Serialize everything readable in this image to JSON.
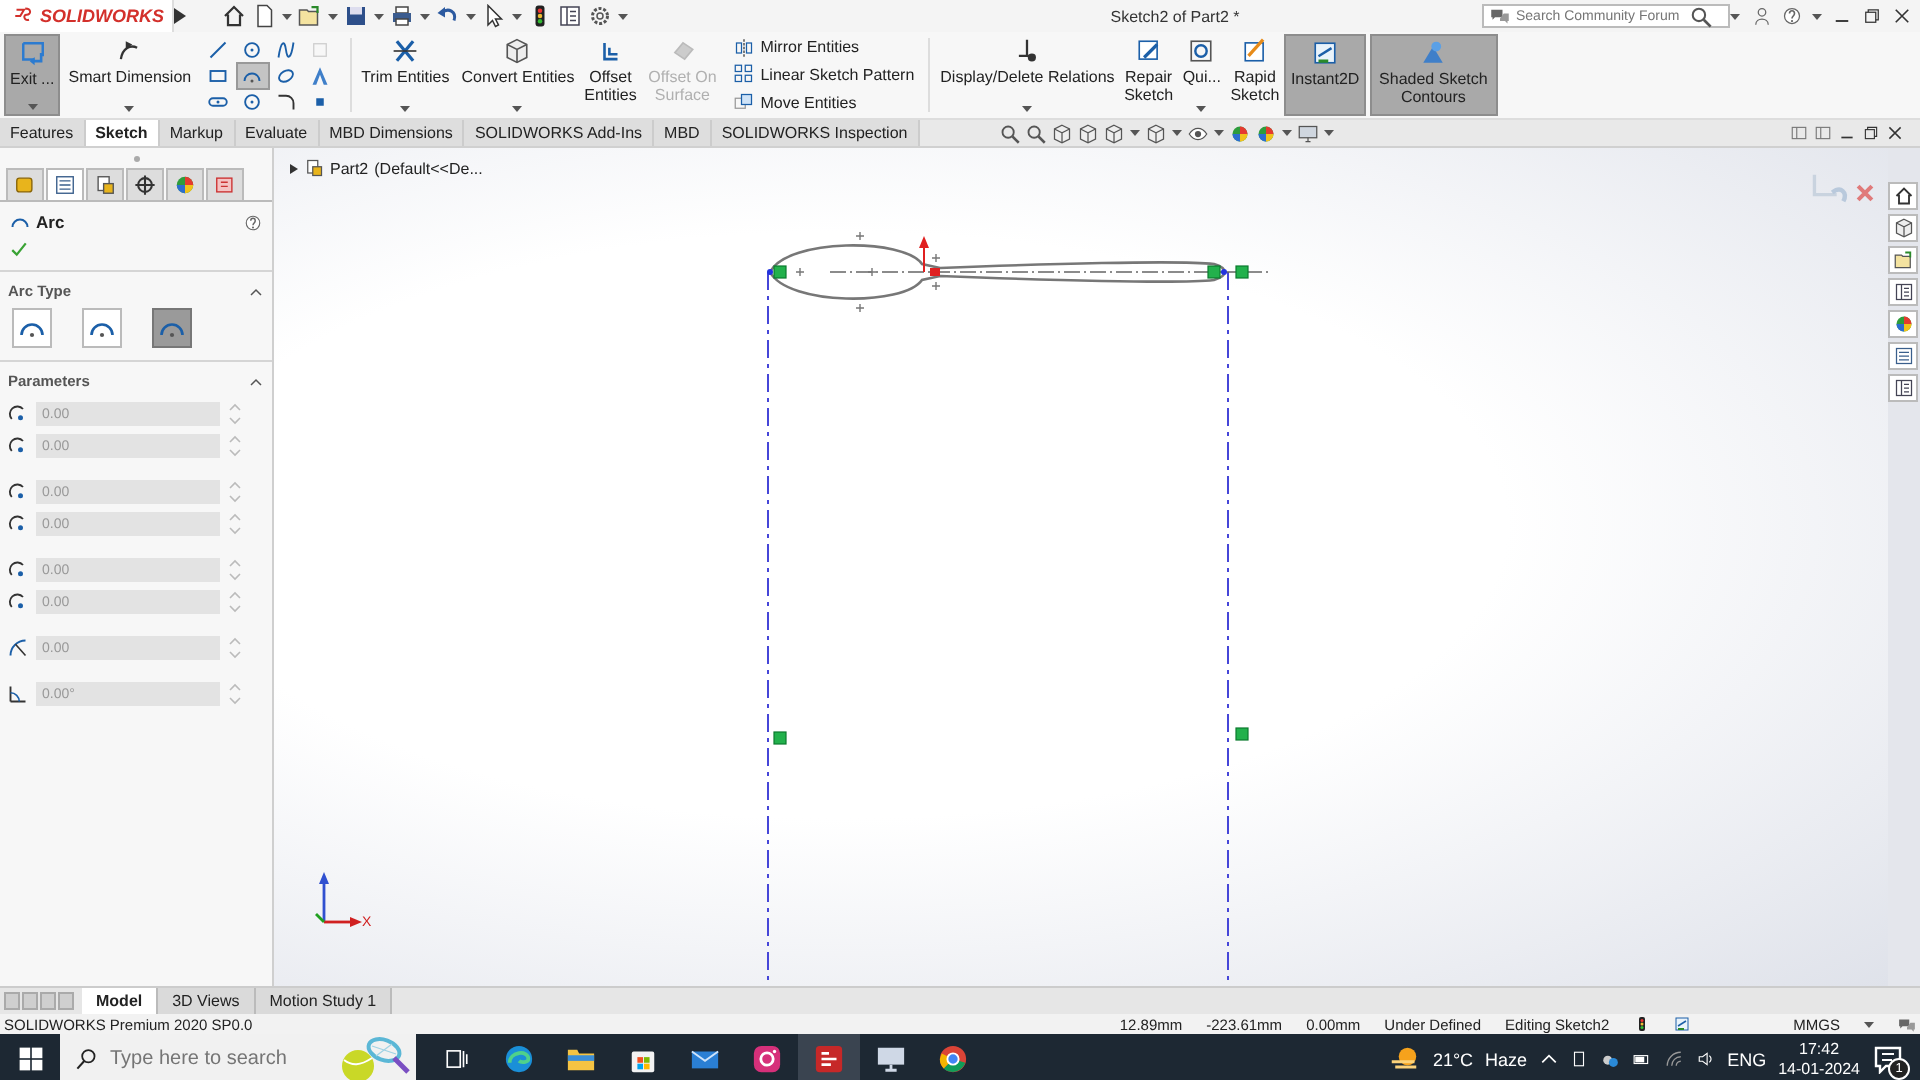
{
  "title_bar": {
    "brand": "SOLIDWORKS",
    "title": "Sketch2 of Part2 *",
    "search": {
      "placeholder": "Search Community Forum"
    }
  },
  "ribbon": [
    {
      "kind": "large",
      "label": "Exit ...",
      "selected": true,
      "disabled": false,
      "dropdown": true
    },
    {
      "kind": "large",
      "label": "Smart Dimension",
      "selected": false,
      "disabled": false,
      "dropdown": true
    },
    {
      "kind": "tools",
      "items": [
        {
          "selected": false
        },
        {
          "selected": false
        },
        {
          "selected": false
        },
        {
          "selected": false
        },
        {
          "selected": false
        },
        {
          "selected": true
        },
        {
          "selected": false
        },
        {
          "selected": false
        },
        {
          "selected": false
        },
        {
          "selected": false
        },
        {
          "selected": false
        },
        {
          "selected": false
        }
      ]
    },
    {
      "kind": "large",
      "label": "Trim Entities",
      "selected": false,
      "disabled": false,
      "dropdown": true
    },
    {
      "kind": "large",
      "label": "Convert Entities",
      "selected": false,
      "disabled": false,
      "dropdown": true
    },
    {
      "kind": "large",
      "label": "Offset Entities",
      "selected": false,
      "disabled": false,
      "dropdown": false
    },
    {
      "kind": "large",
      "label": "Offset On Surface",
      "selected": false,
      "disabled": true,
      "dropdown": false
    },
    {
      "kind": "stack",
      "items": [
        "Mirror Entities",
        "Linear Sketch Pattern",
        "Move Entities"
      ]
    },
    {
      "kind": "large",
      "label": "Display/Delete Relations",
      "selected": false,
      "disabled": false,
      "dropdown": true
    },
    {
      "kind": "large",
      "label": "Repair Sketch",
      "selected": false,
      "disabled": false,
      "dropdown": false
    },
    {
      "kind": "large",
      "label": "Qui...",
      "selected": false,
      "disabled": false,
      "dropdown": true
    },
    {
      "kind": "large",
      "label": "Rapid Sketch",
      "selected": false,
      "disabled": false,
      "dropdown": false
    },
    {
      "kind": "large",
      "label": "Instant2D",
      "selected": true,
      "disabled": false,
      "dropdown": false
    },
    {
      "kind": "large",
      "label": "Shaded Sketch Contours",
      "selected": true,
      "disabled": false,
      "dropdown": false
    }
  ],
  "command_tabs": [
    {
      "label": "Features",
      "selected": false
    },
    {
      "label": "Sketch",
      "selected": true
    },
    {
      "label": "Markup",
      "selected": false
    },
    {
      "label": "Evaluate",
      "selected": false
    },
    {
      "label": "MBD Dimensions",
      "selected": false
    },
    {
      "label": "SOLIDWORKS Add-Ins",
      "selected": false
    },
    {
      "label": "MBD",
      "selected": false
    },
    {
      "label": "SOLIDWORKS Inspection",
      "selected": false
    }
  ],
  "property_manager": {
    "tabs": [
      {
        "selected": false
      },
      {
        "selected": true
      },
      {
        "selected": false
      },
      {
        "selected": false
      },
      {
        "selected": false
      },
      {
        "selected": false
      }
    ],
    "title": "Arc",
    "arc_type": {
      "title": "Arc Type",
      "expanded": true,
      "options": [
        {
          "selected": false
        },
        {
          "selected": false
        },
        {
          "selected": true
        }
      ]
    },
    "parameters": {
      "title": "Parameters",
      "expanded": true,
      "fields": [
        {
          "value": "0.00"
        },
        {
          "value": "0.00"
        },
        {
          "value": "0.00"
        },
        {
          "value": "0.00"
        },
        {
          "value": "0.00"
        },
        {
          "value": "0.00"
        },
        {
          "value": "0.00"
        },
        {
          "value": "0.00°"
        }
      ]
    }
  },
  "feature_tree": {
    "part": "Part2",
    "configuration": "(Default<<De..."
  },
  "canvas": {
    "triad": {
      "x_label": "X"
    }
  },
  "bottom_tabs": [
    {
      "label": "Model",
      "selected": true
    },
    {
      "label": "3D Views",
      "selected": false
    },
    {
      "label": "Motion Study 1",
      "selected": false
    }
  ],
  "status_bar": {
    "product": "SOLIDWORKS Premium 2020 SP0.0",
    "x": "12.89mm",
    "y": "-223.61mm",
    "z": "0.00mm",
    "state": "Under Defined",
    "mode": "Editing Sketch2",
    "units": "MMGS"
  },
  "taskbar": {
    "search": {
      "placeholder": "Type here to search"
    },
    "apps": [
      {
        "kind": "taskview",
        "selected": false
      },
      {
        "kind": "browser",
        "selected": false
      },
      {
        "kind": "folder",
        "selected": false
      },
      {
        "kind": "store",
        "selected": false
      },
      {
        "kind": "mail",
        "selected": false
      },
      {
        "kind": "camera",
        "selected": false
      },
      {
        "kind": "cad",
        "selected": true
      },
      {
        "kind": "display",
        "selected": false
      },
      {
        "kind": "globe",
        "selected": false
      }
    ],
    "weather": {
      "temperature": "21°C",
      "condition": "Haze"
    },
    "language": "ENG",
    "time": "17:42",
    "date": "14-01-2024",
    "notifications": "1"
  }
}
